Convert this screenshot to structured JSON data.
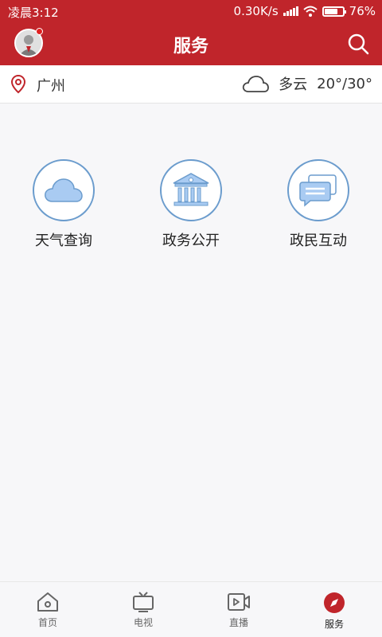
{
  "status_bar": {
    "time": "凌晨3:12",
    "network_speed": "0.30K/s",
    "battery": "76%",
    "battery_level": 0.76
  },
  "header": {
    "title": "服务"
  },
  "weather": {
    "city": "广州",
    "condition": "多云",
    "temperature": "20°/30°"
  },
  "services": [
    {
      "label": "天气查询",
      "icon": "cloud-icon"
    },
    {
      "label": "政务公开",
      "icon": "government-building-icon"
    },
    {
      "label": "政民互动",
      "icon": "chat-bubbles-icon"
    }
  ],
  "tabs": [
    {
      "label": "首页",
      "icon": "home-icon",
      "active": false
    },
    {
      "label": "电视",
      "icon": "tv-icon",
      "active": false
    },
    {
      "label": "直播",
      "icon": "live-video-icon",
      "active": false
    },
    {
      "label": "服务",
      "icon": "compass-icon",
      "active": true
    }
  ],
  "colors": {
    "brand_red": "#c0252b",
    "icon_blue": "#6b9ccd",
    "icon_fill_blue": "#a9cbf2"
  }
}
